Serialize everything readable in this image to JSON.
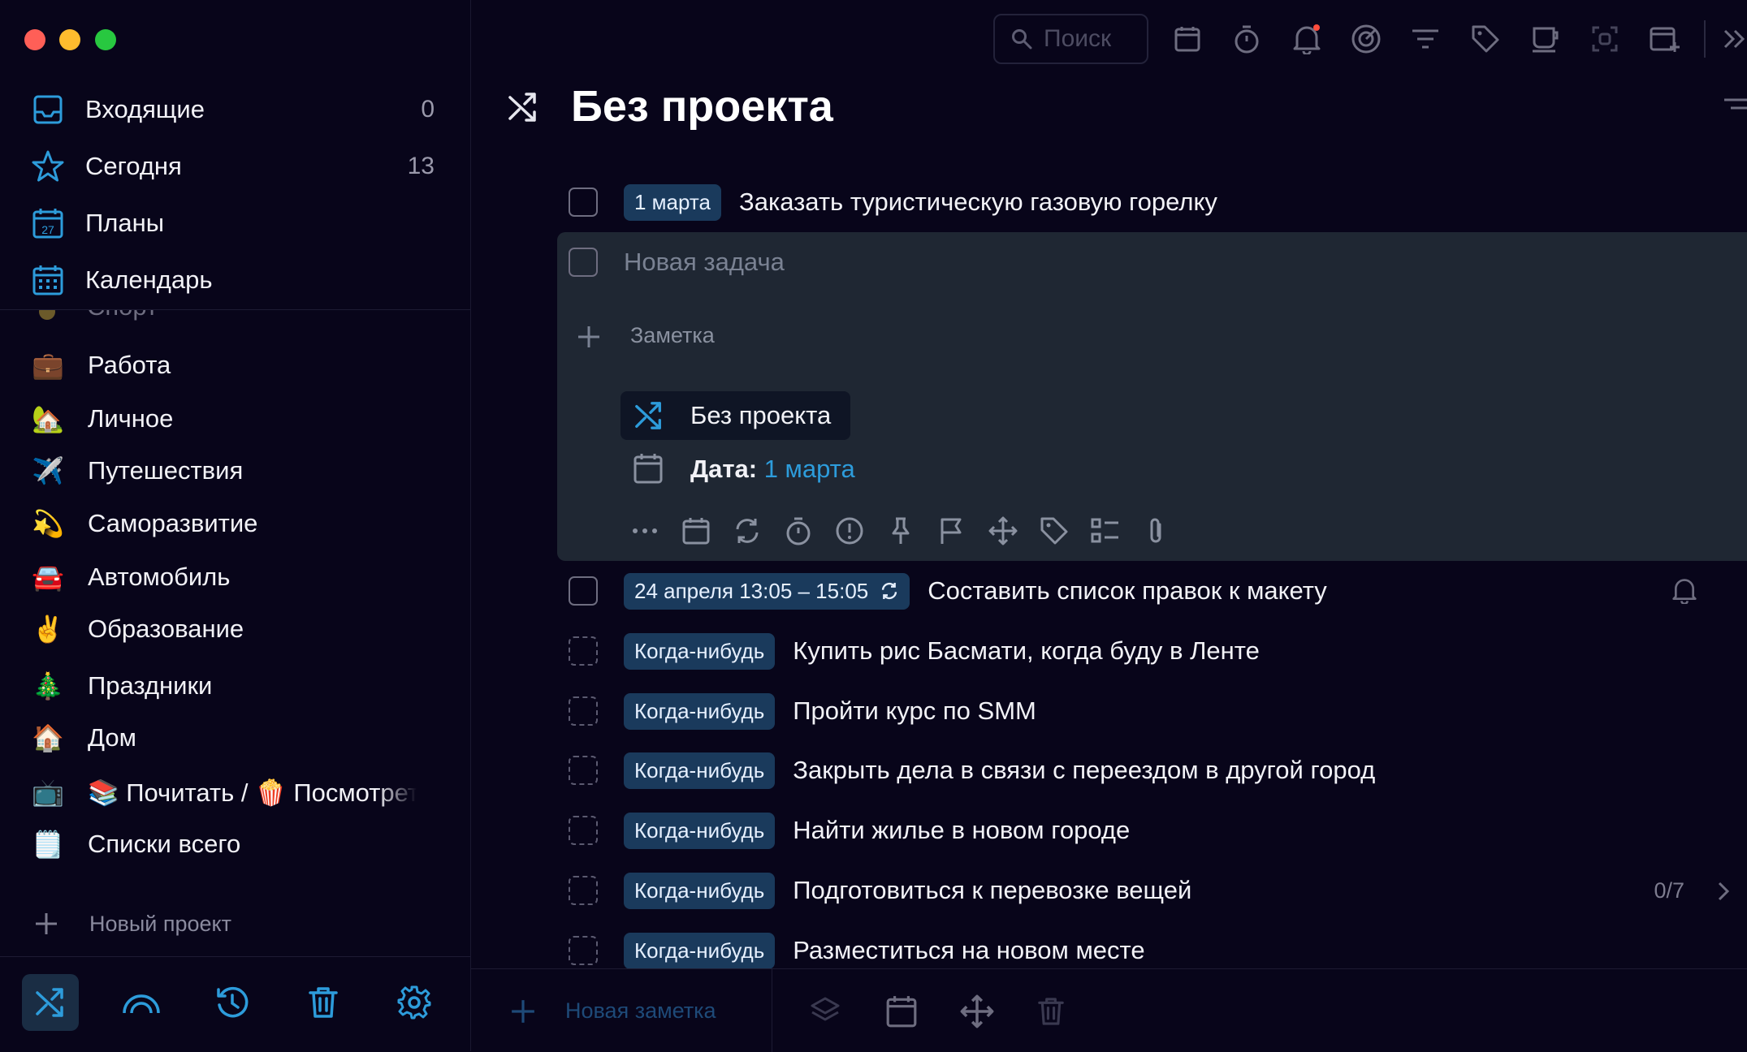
{
  "sidebar": {
    "nav": [
      {
        "label": "Входящие",
        "count": "0",
        "icon": "inbox-icon"
      },
      {
        "label": "Сегодня",
        "count": "13",
        "icon": "star-icon"
      },
      {
        "label": "Планы",
        "count": "",
        "icon": "calendar-27-icon"
      },
      {
        "label": "Календарь",
        "count": "",
        "icon": "calendar-grid-icon"
      }
    ],
    "partial_project": "Спорт",
    "projects": [
      {
        "emoji": "💼",
        "label": "Работа"
      },
      {
        "emoji": "🏡",
        "label": "Личное"
      },
      {
        "emoji": "✈️",
        "label": "Путешествия"
      },
      {
        "emoji": "💫",
        "label": "Саморазвитие"
      },
      {
        "emoji": "🚘",
        "label": "Автомобиль"
      },
      {
        "emoji": "✌️",
        "label": "Образование"
      },
      {
        "emoji": "🎄",
        "label": "Праздники"
      },
      {
        "emoji": "🏠",
        "label": "Дом"
      },
      {
        "emoji": "📺",
        "label": "📚 Почитать / 🍿 Посмотреть"
      },
      {
        "emoji": "🗒️",
        "label": "Списки всего"
      }
    ],
    "new_project": "Новый проект"
  },
  "toolbar": {
    "search_placeholder": "Поиск"
  },
  "main": {
    "title": "Без проекта",
    "tasks": [
      {
        "tag": "1 марта",
        "text": "Заказать туристическую газовую горелку"
      },
      {
        "tag": "24 апреля 13:05 – 15:05",
        "text": "Составить список правок к макету"
      },
      {
        "tag": "Когда-нибудь",
        "text": "Купить рис Басмати, когда буду в Ленте"
      },
      {
        "tag": "Когда-нибудь",
        "text": "Пройти курс по SMM"
      },
      {
        "tag": "Когда-нибудь",
        "text": "Закрыть дела в связи с переездом в другой город"
      },
      {
        "tag": "Когда-нибудь",
        "text": "Найти жилье в новом городе"
      },
      {
        "tag": "Когда-нибудь",
        "text": "Подготовиться к перевозке вещей",
        "progress": "0/7"
      },
      {
        "tag": "Когда-нибудь",
        "text": "Разместиться на новом месте"
      }
    ],
    "editor": {
      "title_placeholder": "Новая задача",
      "note_label": "Заметка",
      "project_label": "Без проекта",
      "date_label": "Дата:",
      "date_value": "1 марта"
    }
  },
  "bottombar": {
    "new_note": "Новая заметка"
  },
  "colors": {
    "accent": "#2d9cdb",
    "tag_bg": "#1a3a5c",
    "editor_bg": "#1f2733",
    "bg": "#08051a"
  }
}
